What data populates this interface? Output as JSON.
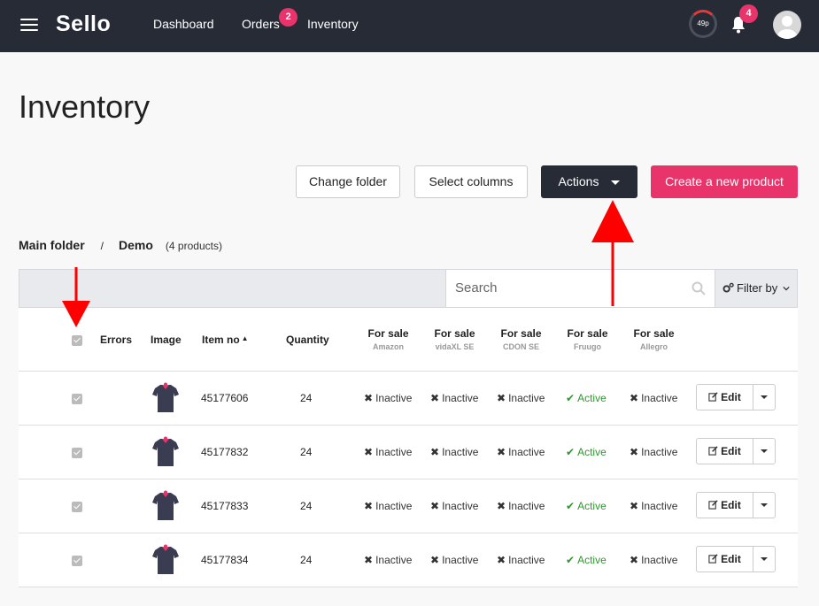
{
  "nav": {
    "logo": "Sello",
    "links": [
      "Dashboard",
      "Orders",
      "Inventory"
    ],
    "orders_badge": "2",
    "quota": "49p",
    "notifications_badge": "4"
  },
  "page": {
    "title": "Inventory",
    "buttons": {
      "change_folder": "Change folder",
      "select_columns": "Select columns",
      "actions": "Actions",
      "create_product": "Create a new product"
    },
    "breadcrumb": {
      "root": "Main folder",
      "separator": "/",
      "current": "Demo",
      "count": "(4 products)"
    }
  },
  "toolbar": {
    "search_placeholder": "Search",
    "filter_label": "Filter by"
  },
  "table": {
    "headers": {
      "errors": "Errors",
      "image": "Image",
      "item_no": "Item no",
      "quantity": "Quantity",
      "channels": [
        {
          "label": "For sale",
          "sub": "Amazon"
        },
        {
          "label": "For sale",
          "sub": "vidaXL SE"
        },
        {
          "label": "For sale",
          "sub": "CDON SE"
        },
        {
          "label": "For sale",
          "sub": "Fruugo"
        },
        {
          "label": "For sale",
          "sub": "Allegro"
        }
      ]
    },
    "edit_label": "Edit",
    "rows": [
      {
        "item_no": "45177606",
        "quantity": "24",
        "statuses": [
          "Inactive",
          "Inactive",
          "Inactive",
          "Active",
          "Inactive"
        ]
      },
      {
        "item_no": "45177832",
        "quantity": "24",
        "statuses": [
          "Inactive",
          "Inactive",
          "Inactive",
          "Active",
          "Inactive"
        ]
      },
      {
        "item_no": "45177833",
        "quantity": "24",
        "statuses": [
          "Inactive",
          "Inactive",
          "Inactive",
          "Active",
          "Inactive"
        ]
      },
      {
        "item_no": "45177834",
        "quantity": "24",
        "statuses": [
          "Inactive",
          "Inactive",
          "Inactive",
          "Active",
          "Inactive"
        ]
      }
    ]
  },
  "colors": {
    "topbar": "#262b36",
    "accent_pink": "#e8336b",
    "active_green": "#2a9a2a",
    "annotation_red": "#ff0000"
  },
  "icons": {
    "menu": "hamburger-icon",
    "notifications": "bell-icon",
    "user": "user-avatar-icon",
    "search": "search-icon",
    "filter": "gears-icon",
    "inactive": "x-icon",
    "active": "checkmark-icon",
    "edit": "pencil-square-icon",
    "sort": "sort-up-icon"
  }
}
